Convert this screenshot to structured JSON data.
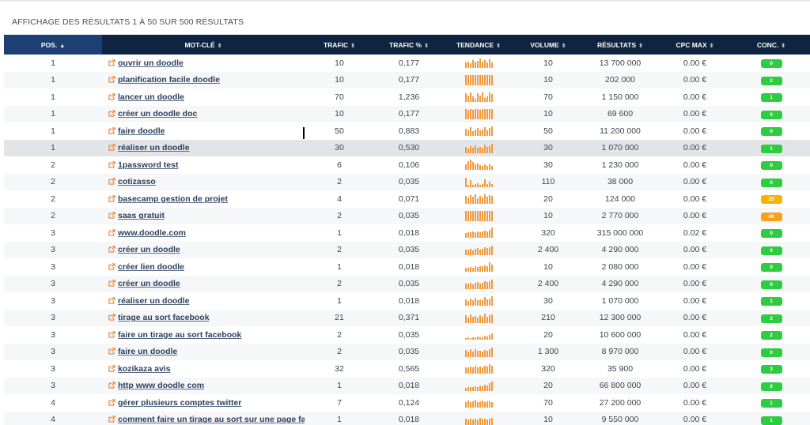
{
  "summary": "AFFICHAGE DES RÉSULTATS 1 À 50 SUR 500 RÉSULTATS",
  "columns": {
    "pos": "POS.",
    "keyword": "MOT-CLÉ",
    "traffic": "TRAFIC",
    "traffic_pct": "TRAFIC %",
    "trend": "TENDANCE",
    "volume": "VOLUME",
    "results": "RÉSULTATS",
    "cpc": "CPC MAX",
    "comp": "CONC."
  },
  "sort_icons": {
    "active": "sort-asc-icon",
    "default": "sort-both-icon"
  },
  "colors": {
    "header_bg": "#0f2440",
    "header_active_bg": "#1d3f73",
    "trend_bar": "#f39a3d",
    "badge_green": "#2ecc40",
    "badge_yellow": "#f5b400",
    "badge_orange": "#f7a11a",
    "link": "#2b3f5e",
    "ext_icon": "#f0802a"
  },
  "rows": [
    {
      "pos": "1",
      "keyword": "ouvrir un doodle",
      "traffic": "10",
      "traffic_pct": "0,177",
      "volume": "10",
      "results": "13 700 000",
      "cpc": "0.00 €",
      "comp": "0",
      "comp_color": "green",
      "trend": [
        0.55,
        0.65,
        0.45,
        0.8,
        0.6,
        0.7,
        0.9,
        0.6,
        0.75,
        0.55,
        0.85,
        0.5
      ]
    },
    {
      "pos": "1",
      "keyword": "planification facile doodle",
      "traffic": "10",
      "traffic_pct": "0,177",
      "volume": "10",
      "results": "202 000",
      "cpc": "0.00 €",
      "comp": "2",
      "comp_color": "green",
      "trend": [
        1,
        1,
        1,
        1,
        1,
        1,
        1,
        1,
        1,
        1,
        1,
        1
      ]
    },
    {
      "pos": "1",
      "keyword": "lancer un doodle",
      "traffic": "70",
      "traffic_pct": "1,236",
      "volume": "70",
      "results": "1 150 000",
      "cpc": "0.00 €",
      "comp": "1",
      "comp_color": "green",
      "trend": [
        0.85,
        0.6,
        0.9,
        0.5,
        0.3,
        0.85,
        0.65,
        0.95,
        0.4,
        0.55,
        0.9,
        0.8
      ]
    },
    {
      "pos": "1",
      "keyword": "créer un doodle doc",
      "traffic": "10",
      "traffic_pct": "0,177",
      "volume": "10",
      "results": "69 600",
      "cpc": "0.00 €",
      "comp": "0",
      "comp_color": "green",
      "trend": [
        1,
        0.95,
        1,
        0.95,
        1,
        1,
        0.95,
        1,
        1,
        1,
        1,
        1
      ]
    },
    {
      "pos": "1",
      "keyword": "faire doodle",
      "traffic": "50",
      "traffic_pct": "0,883",
      "volume": "50",
      "results": "11 200 000",
      "cpc": "0.00 €",
      "comp": "0",
      "comp_color": "green",
      "trend": [
        0.7,
        0.55,
        0.85,
        0.45,
        0.6,
        0.8,
        0.5,
        0.65,
        0.85,
        0.55,
        0.75,
        0.9
      ]
    },
    {
      "pos": "1",
      "keyword": "réaliser un doodle",
      "traffic": "30",
      "traffic_pct": "0,530",
      "volume": "30",
      "results": "1 070 000",
      "cpc": "0.00 €",
      "comp": "1",
      "comp_color": "green",
      "trend": [
        0.6,
        0.45,
        0.7,
        0.5,
        0.8,
        0.55,
        0.65,
        0.5,
        0.85,
        0.6,
        0.7,
        0.9
      ]
    },
    {
      "pos": "2",
      "keyword": "1password test",
      "traffic": "6",
      "traffic_pct": "0,106",
      "volume": "30",
      "results": "1 230 000",
      "cpc": "0.00 €",
      "comp": "0",
      "comp_color": "green",
      "trend": [
        0.5,
        0.85,
        1,
        0.75,
        0.55,
        0.6,
        0.45,
        0.35,
        0.5,
        0.4,
        0.5,
        0.35
      ]
    },
    {
      "pos": "2",
      "keyword": "cotizasso",
      "traffic": "2",
      "traffic_pct": "0,035",
      "volume": "110",
      "results": "38 000",
      "cpc": "0.00 €",
      "comp": "0",
      "comp_color": "green",
      "trend": [
        0.9,
        0.2,
        0.7,
        0.25,
        0.3,
        0.35,
        0.25,
        0.3,
        0.75,
        0.3,
        0.55,
        0.3
      ]
    },
    {
      "pos": "2",
      "keyword": "basecamp gestion de projet",
      "traffic": "4",
      "traffic_pct": "0,071",
      "volume": "20",
      "results": "124 000",
      "cpc": "0.00 €",
      "comp": "25",
      "comp_color": "yellow",
      "trend": [
        0.75,
        0.6,
        0.85,
        0.7,
        0.9,
        0.55,
        0.8,
        0.65,
        0.95,
        0.7,
        0.85,
        0.75
      ]
    },
    {
      "pos": "2",
      "keyword": "saas gratuit",
      "traffic": "2",
      "traffic_pct": "0,035",
      "volume": "10",
      "results": "2 770 000",
      "cpc": "0.00 €",
      "comp": "40",
      "comp_color": "orange",
      "trend": [
        1,
        1,
        1,
        1,
        1,
        1,
        1,
        1,
        1,
        1,
        1,
        1
      ]
    },
    {
      "pos": "3",
      "keyword": "www.doodle.com",
      "traffic": "1",
      "traffic_pct": "0,018",
      "volume": "320",
      "results": "315 000 000",
      "cpc": "0.02 €",
      "comp": "0",
      "comp_color": "green",
      "trend": [
        0.45,
        0.5,
        0.55,
        0.6,
        0.5,
        0.65,
        0.55,
        0.6,
        0.7,
        0.65,
        0.75,
        1
      ]
    },
    {
      "pos": "3",
      "keyword": "créer un doodle",
      "traffic": "2",
      "traffic_pct": "0,035",
      "volume": "2 400",
      "results": "4 290 000",
      "cpc": "0.00 €",
      "comp": "0",
      "comp_color": "green",
      "trend": [
        0.5,
        0.55,
        0.6,
        0.45,
        0.65,
        0.7,
        0.55,
        0.6,
        0.75,
        0.7,
        0.8,
        0.9
      ]
    },
    {
      "pos": "3",
      "keyword": "créer lien doodle",
      "traffic": "1",
      "traffic_pct": "0,018",
      "volume": "10",
      "results": "2 080 000",
      "cpc": "0.00 €",
      "comp": "0",
      "comp_color": "green",
      "trend": [
        0.35,
        0.4,
        0.45,
        0.4,
        0.5,
        0.45,
        0.55,
        0.5,
        0.6,
        0.55,
        0.95,
        0.7
      ]
    },
    {
      "pos": "3",
      "keyword": "créer un doodle",
      "traffic": "2",
      "traffic_pct": "0,035",
      "volume": "2 400",
      "results": "4 290 000",
      "cpc": "0.00 €",
      "comp": "0",
      "comp_color": "green",
      "trend": [
        0.5,
        0.55,
        0.6,
        0.45,
        0.65,
        0.7,
        0.55,
        0.6,
        0.75,
        0.7,
        0.8,
        0.9
      ]
    },
    {
      "pos": "3",
      "keyword": "réaliser un doodle",
      "traffic": "1",
      "traffic_pct": "0,018",
      "volume": "30",
      "results": "1 070 000",
      "cpc": "0.00 €",
      "comp": "1",
      "comp_color": "green",
      "trend": [
        0.6,
        0.45,
        0.7,
        0.5,
        0.8,
        0.55,
        0.65,
        0.5,
        0.85,
        0.6,
        0.7,
        0.9
      ]
    },
    {
      "pos": "3",
      "keyword": "tirage au sort facebook",
      "traffic": "21",
      "traffic_pct": "0,371",
      "volume": "210",
      "results": "12 300 000",
      "cpc": "0.00 €",
      "comp": "2",
      "comp_color": "green",
      "trend": [
        0.75,
        0.55,
        0.85,
        0.6,
        0.7,
        0.5,
        0.8,
        0.65,
        0.9,
        0.6,
        0.75,
        0.85
      ]
    },
    {
      "pos": "3",
      "keyword": "faire un tirage au sort facebook",
      "traffic": "2",
      "traffic_pct": "0,035",
      "volume": "20",
      "results": "10 600 000",
      "cpc": "0.00 €",
      "comp": "2",
      "comp_color": "green",
      "trend": [
        0.15,
        0.2,
        0.15,
        0.25,
        0.2,
        0.3,
        0.2,
        0.25,
        0.35,
        0.3,
        0.45,
        0.6
      ]
    },
    {
      "pos": "3",
      "keyword": "faire un doodle",
      "traffic": "2",
      "traffic_pct": "0,035",
      "volume": "1 300",
      "results": "8 970 000",
      "cpc": "0.00 €",
      "comp": "0",
      "comp_color": "green",
      "trend": [
        0.7,
        0.5,
        0.8,
        0.55,
        0.75,
        0.6,
        0.65,
        0.55,
        0.7,
        0.6,
        0.75,
        0.9
      ]
    },
    {
      "pos": "3",
      "keyword": "kozikaza avis",
      "traffic": "32",
      "traffic_pct": "0,565",
      "volume": "320",
      "results": "35 900",
      "cpc": "0.00 €",
      "comp": "3",
      "comp_color": "green",
      "trend": [
        0.65,
        0.6,
        0.7,
        0.65,
        0.75,
        0.6,
        0.7,
        0.65,
        0.8,
        0.7,
        0.9,
        0.75
      ]
    },
    {
      "pos": "3",
      "keyword": "http www doodle com",
      "traffic": "1",
      "traffic_pct": "0,018",
      "volume": "20",
      "results": "66 800 000",
      "cpc": "0.00 €",
      "comp": "0",
      "comp_color": "green",
      "trend": [
        0.3,
        0.35,
        0.4,
        0.35,
        0.45,
        0.4,
        0.5,
        0.45,
        0.6,
        0.55,
        0.75,
        0.95
      ]
    },
    {
      "pos": "4",
      "keyword": "gérer plusieurs comptes twitter",
      "traffic": "7",
      "traffic_pct": "0,124",
      "volume": "70",
      "results": "27 200 000",
      "cpc": "0.00 €",
      "comp": "1",
      "comp_color": "green",
      "trend": [
        0.55,
        0.7,
        0.5,
        0.65,
        0.75,
        0.55,
        0.6,
        0.7,
        0.5,
        0.65,
        0.6,
        0.55
      ]
    },
    {
      "pos": "4",
      "keyword": "comment faire un tirage au sort sur une page face",
      "traffic": "1",
      "traffic_pct": "0,018",
      "volume": "10",
      "results": "9 550 000",
      "cpc": "0.00 €",
      "comp": "1",
      "comp_color": "green",
      "trend": [
        0.6,
        0.55,
        0.65,
        0.5,
        0.6,
        0.55,
        0.7,
        0.6,
        0.65,
        0.55,
        0.6,
        0.7
      ]
    }
  ]
}
